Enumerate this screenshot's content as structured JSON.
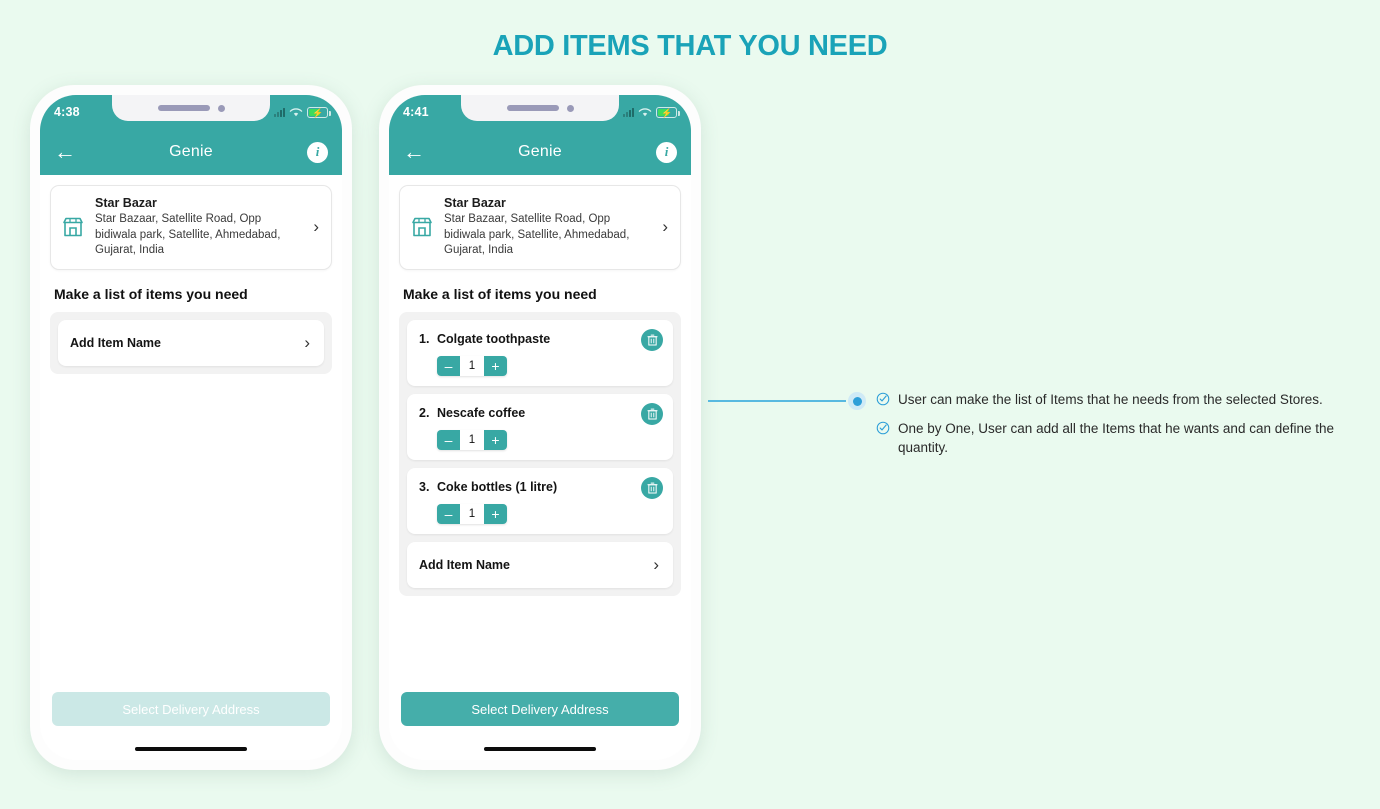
{
  "page": {
    "title": "ADD ITEMS THAT YOU NEED",
    "background_color": "#eafaef",
    "accent_color": "#38a8a4",
    "title_color": "#1aa3b8",
    "annotation_color": "#2e9fd8"
  },
  "phone_left": {
    "status": {
      "time": "4:38",
      "signal_icon": "signal-bars-icon",
      "wifi_icon": "wifi-icon",
      "battery_icon": "battery-charging-icon"
    },
    "appbar": {
      "back_icon": "back-arrow-icon",
      "title": "Genie",
      "info_icon": "info-icon",
      "info_label": "i"
    },
    "store": {
      "icon": "storefront-icon",
      "name": "Star Bazar",
      "address": "Star Bazaar, Satellite Road, Opp bidiwala park, Satellite, Ahmedabad, Gujarat, India",
      "chevron_icon": "chevron-right-icon"
    },
    "section_title": "Make a list of items you need",
    "items": [],
    "add_item": {
      "label": "Add Item Name",
      "chevron_icon": "chevron-right-icon"
    },
    "cta": {
      "label": "Select Delivery Address",
      "state": "disabled"
    }
  },
  "phone_right": {
    "status": {
      "time": "4:41",
      "signal_icon": "signal-bars-icon",
      "wifi_icon": "wifi-icon",
      "battery_icon": "battery-charging-icon"
    },
    "appbar": {
      "back_icon": "back-arrow-icon",
      "title": "Genie",
      "info_icon": "info-icon",
      "info_label": "i"
    },
    "store": {
      "icon": "storefront-icon",
      "name": "Star Bazar",
      "address": "Star Bazaar, Satellite Road, Opp bidiwala park, Satellite, Ahmedabad, Gujarat, India",
      "chevron_icon": "chevron-right-icon"
    },
    "section_title": "Make a list of items you need",
    "items": [
      {
        "number": "1.",
        "name": "Colgate toothpaste",
        "quantity": "1",
        "minus_label": "–",
        "plus_label": "+",
        "delete_icon": "trash-icon"
      },
      {
        "number": "2.",
        "name": "Nescafe coffee",
        "quantity": "1",
        "minus_label": "–",
        "plus_label": "+",
        "delete_icon": "trash-icon"
      },
      {
        "number": "3.",
        "name": "Coke bottles (1 litre)",
        "quantity": "1",
        "minus_label": "–",
        "plus_label": "+",
        "delete_icon": "trash-icon"
      }
    ],
    "add_item": {
      "label": "Add Item Name",
      "chevron_icon": "chevron-right-icon"
    },
    "cta": {
      "label": "Select Delivery Address",
      "state": "enabled"
    }
  },
  "annotation": {
    "marker_icon": "connector-dot-icon",
    "notes": [
      {
        "icon": "check-circle-icon",
        "text": "User can make the list of Items that he needs from the selected Stores."
      },
      {
        "icon": "check-circle-icon",
        "text": "One by One, User can add all the Items that he wants and can define the quantity."
      }
    ]
  }
}
